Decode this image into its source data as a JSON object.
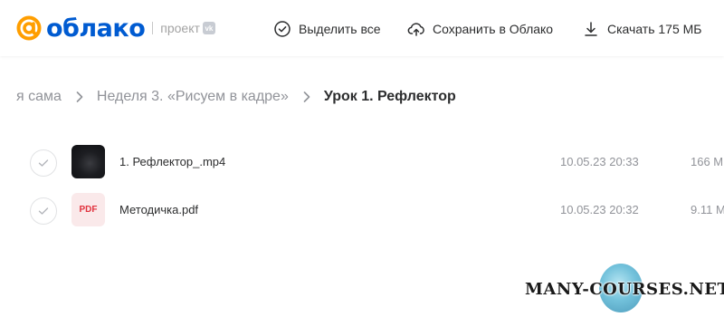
{
  "header": {
    "logo_text": "облако",
    "project_label": "проект",
    "vk_badge": "vk",
    "actions": [
      {
        "label": "Выделить все",
        "icon": "check-circle-icon"
      },
      {
        "label": "Сохранить в Облако",
        "icon": "cloud-upload-icon"
      },
      {
        "label": "Скачать 175 МБ",
        "icon": "download-icon"
      }
    ]
  },
  "colors": {
    "brand_orange": "#ff9e00",
    "brand_blue": "#005bd1",
    "text_primary": "#2c2d2e",
    "text_secondary": "#919399",
    "pdf_red": "#e1333e"
  },
  "breadcrumb": {
    "items": [
      "я сама",
      "Неделя 3. «Рисуем в кадре»",
      "Урок 1. Рефлектор"
    ],
    "separator_icon": "chevron-right-icon"
  },
  "files": [
    {
      "name": "1. Рефлектор_.mp4",
      "date": "10.05.23 20:33",
      "size": "166 М",
      "type": "video"
    },
    {
      "name": "Методичка.pdf",
      "date": "10.05.23 20:32",
      "size": "9.11 М",
      "type": "pdf",
      "badge": "PDF"
    }
  ],
  "watermark": "MANY-COURSES.NET"
}
